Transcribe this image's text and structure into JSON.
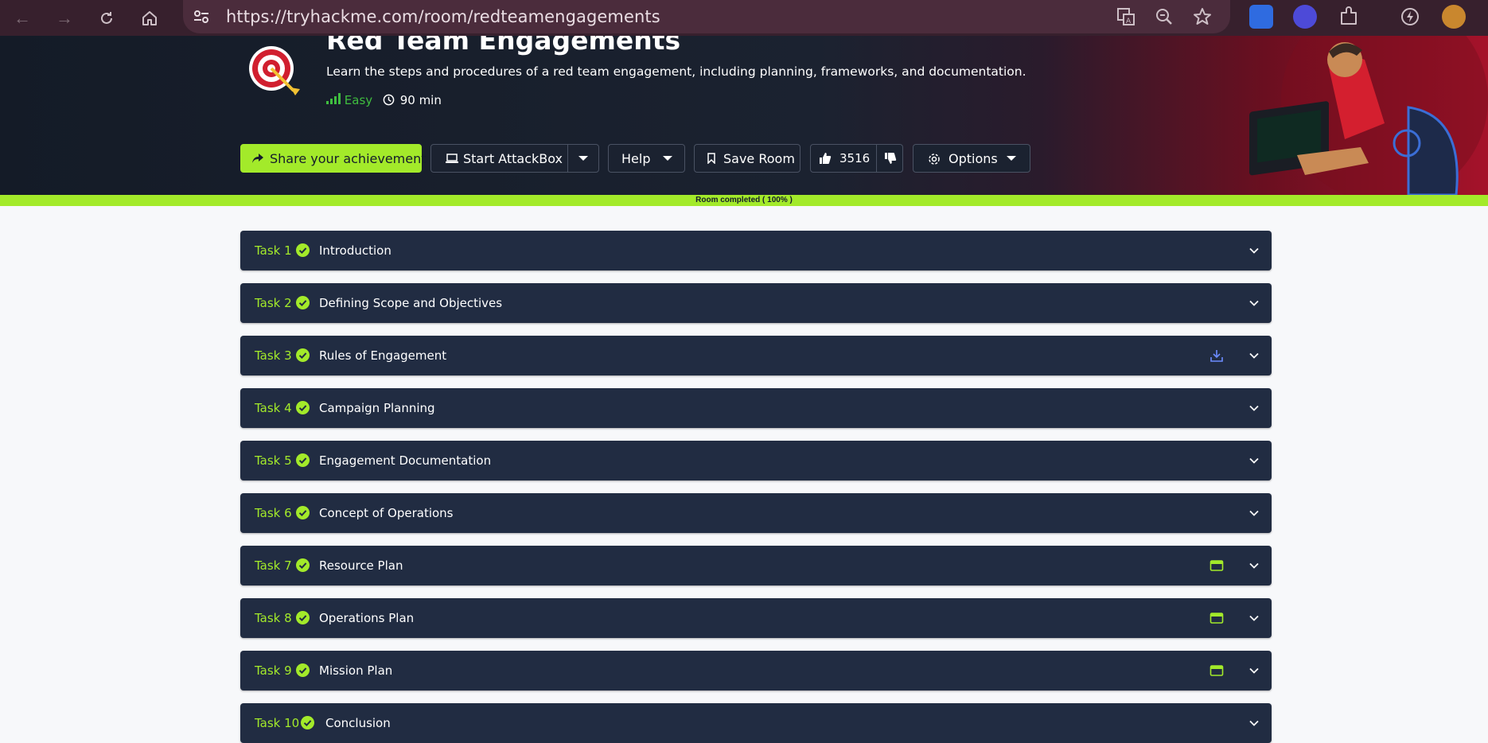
{
  "browser": {
    "url": "https://tryhackme.com/room/redteamengagements"
  },
  "room": {
    "title": "Red Team Engagements",
    "description": "Learn the steps and procedures of a red team engagement, including planning, frameworks, and documentation.",
    "difficulty": "Easy",
    "duration": "90 min",
    "difficulty_color": "#3fbd3f"
  },
  "toolbar": {
    "share_label": "Share your achievement",
    "attackbox_label": "Start AttackBox",
    "help_label": "Help",
    "save_label": "Save Room",
    "likes": "3516",
    "options_label": "Options"
  },
  "progress": {
    "text": "Room completed ( 100% )",
    "value": 100
  },
  "colors": {
    "accent": "#a3ea2a",
    "task_bg": "#212c42",
    "page_bg": "#f7f8fa"
  },
  "tasks": [
    {
      "num": "Task 1",
      "title": "Introduction",
      "icon": ""
    },
    {
      "num": "Task 2",
      "title": "Defining Scope and Objectives",
      "icon": ""
    },
    {
      "num": "Task 3",
      "title": "Rules of Engagement",
      "icon": "download-icon"
    },
    {
      "num": "Task 4",
      "title": "Campaign Planning",
      "icon": ""
    },
    {
      "num": "Task 5",
      "title": "Engagement Documentation",
      "icon": ""
    },
    {
      "num": "Task 6",
      "title": "Concept of Operations",
      "icon": ""
    },
    {
      "num": "Task 7",
      "title": "Resource Plan",
      "icon": "browser-window-icon"
    },
    {
      "num": "Task 8",
      "title": "Operations Plan",
      "icon": "browser-window-icon"
    },
    {
      "num": "Task 9",
      "title": "Mission Plan",
      "icon": "browser-window-icon"
    },
    {
      "num": "Task 10",
      "title": "Conclusion",
      "icon": ""
    }
  ]
}
